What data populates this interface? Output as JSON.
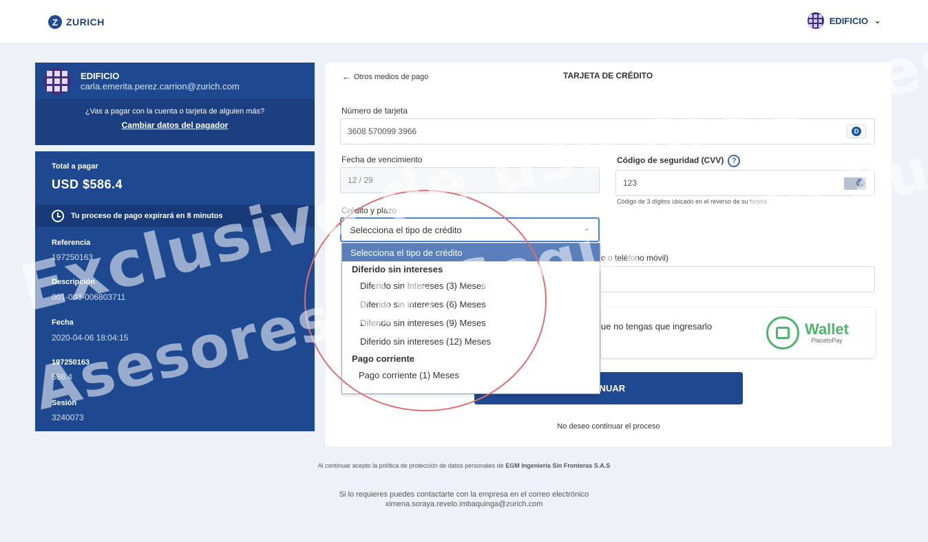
{
  "header": {
    "logo_text": "ZURICH",
    "logo_mark": "Z",
    "account_name": "EDIFICIO",
    "chevron": "⌄"
  },
  "user_card": {
    "name": "EDIFICIO",
    "email": "carla.emerita.perez.carrion@zurich.com",
    "question": "¿Vas a pagar con la cuenta o tarjeta de alguien más?",
    "change_payer": "Cambiar datos del pagador"
  },
  "summary": {
    "total_label": "Total a pagar",
    "total_value": "USD $586.4",
    "timer_text": "Tu proceso de pago expirará en 8 minutos",
    "reference_label": "Referencia",
    "reference_value": "197250163",
    "description_label": "Descripción",
    "description_value": "001-003-006803711",
    "date_label": "Fecha",
    "date_value": "2020-04-06 18:04:15",
    "extra_label": "197250163",
    "extra_value": "586.4",
    "session_label": "Sesión",
    "session_value": "3240073"
  },
  "payment": {
    "back_text": "Otros medios de pago",
    "back_arrow": "←",
    "title": "TARJETA DE CRÉDITO",
    "card_number_label": "Número de tarjeta",
    "card_number_value": "3608 570099 3966",
    "card_brand_letter": "D",
    "expiry_label": "Fecha de vencimiento",
    "expiry_value": "12 / 29",
    "cvv_label": "Código de seguridad (CVV)",
    "cvv_help": "?",
    "cvv_value": "123",
    "cvv_badge": "123",
    "cvv_hint": "Código de 3 dígitos ubicado en el reverso de su tarjeta",
    "credit_label": "Crédito y plazo",
    "credit_selected": "Selecciona el tipo de crédito",
    "chevron": "⌄",
    "dropdown": {
      "placeholder": "Selecciona el tipo de crédito",
      "group1": "Diferido sin intereses",
      "options1": [
        "Diferido sin intereses (3) Meses",
        "Diferido sin intereses (6) Meses",
        "Diferido sin intereses (9) Meses",
        "Diferido sin intereses (12) Meses"
      ],
      "group2": "Pago corriente",
      "options2": [
        "Pago corriente (1) Meses"
      ]
    },
    "phone_label_partial": "o o teléfono móvil)",
    "wallet_text_partial": "ue no tengas que ingresarlo",
    "wallet_name": "Wallet",
    "wallet_sub": "PlacetoPay",
    "continue_partial": "TINUAR",
    "cancel_text": "No deseo continuar el proceso"
  },
  "footer": {
    "policy_prefix": "Al continuar acepto la política de protección de datos personales de ",
    "policy_company": "EGM Ingeniería Sin Fronteras S.A.S",
    "contact_line1": "Si lo requieres puedes contactarte con la empresa en el correo electrónico",
    "contact_line2": "ximena.soraya.revelo.imbaquinga@zurich.com"
  },
  "watermarks": {
    "line1": "Exclusivo de uso asesores",
    "line2": "Asesores de Seguros de Zurich"
  },
  "colors": {
    "primary": "#1e4890",
    "wallet_green": "#4fb46b",
    "annotation_red": "#e06f6f"
  }
}
